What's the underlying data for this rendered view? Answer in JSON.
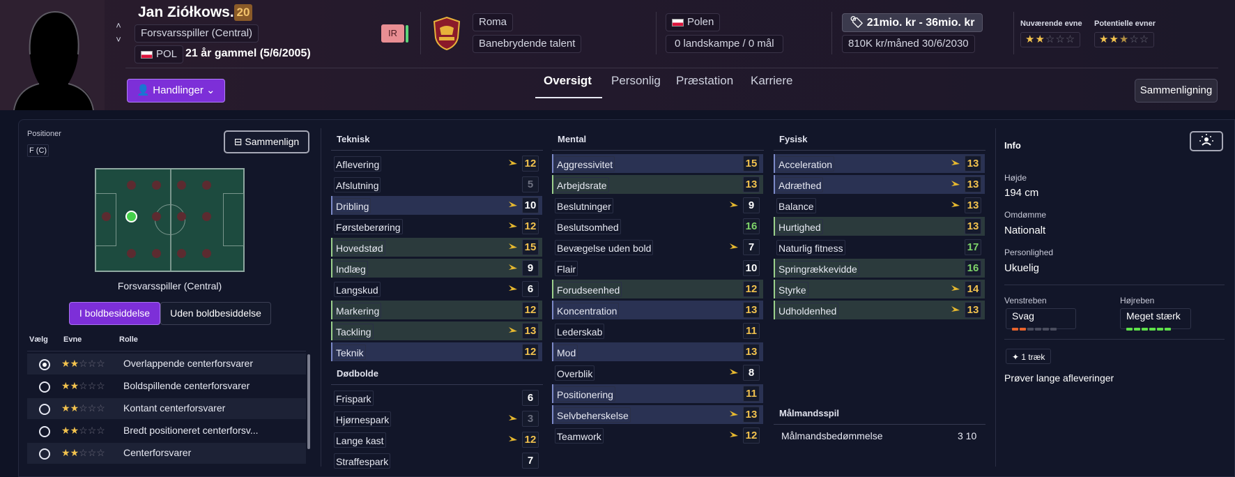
{
  "player": {
    "name": "Jan Ziółkows...",
    "age_badge": "20",
    "position_chip": "Forsvarsspiller (Central)",
    "nationality_code": "POL",
    "age_text": "21 år gammel (5/6/2005)",
    "injury_badge": "IR"
  },
  "club": {
    "name": "Roma",
    "status": "Banebrydende talent"
  },
  "nation": {
    "name": "Polen",
    "caps": "0 landskampe / 0 mål"
  },
  "contract": {
    "value": "21mio. kr - 36mio. kr",
    "wage": "810K kr/måned 30/6/2030"
  },
  "ability": {
    "current_label": "Nuværende evne",
    "current_stars": "★★☆☆☆",
    "current_level": 2,
    "potential_label": "Potentielle evner",
    "potential_stars": "★★★☆☆",
    "potential_level": 2.5
  },
  "nav": {
    "actions_label": "Handlinger",
    "tabs": [
      "Oversigt",
      "Personlig",
      "Præstation",
      "Karriere"
    ],
    "active_tab": "Oversigt",
    "compare_label": "Sammenligning"
  },
  "positions": {
    "label": "Positioner",
    "code": "F (C)",
    "compare_button": "Sammenlign",
    "selected_position": "Forsvarsspiller (Central)",
    "toggle_on": "I boldbesiddelse",
    "toggle_off": "Uden boldbesiddelse",
    "col_select": "Vælg",
    "col_ability": "Evne",
    "col_role": "Rolle",
    "roles": [
      {
        "name": "Overlappende centerforsvarer",
        "stars": 2,
        "selected": true
      },
      {
        "name": "Boldspillende centerforsvarer",
        "stars": 2,
        "selected": false
      },
      {
        "name": "Kontant centerforsvarer",
        "stars": 2,
        "selected": false
      },
      {
        "name": "Bredt positioneret centerforsv...",
        "stars": 2,
        "selected": false
      },
      {
        "name": "Centerforsvarer",
        "stars": 2,
        "selected": false
      }
    ]
  },
  "attributes": {
    "technical_title": "Teknisk",
    "technical": [
      {
        "name": "Aflevering",
        "value": "12",
        "color": "yellow",
        "trend": true,
        "hl": ""
      },
      {
        "name": "Afslutning",
        "value": "5",
        "color": "grey",
        "trend": false,
        "hl": ""
      },
      {
        "name": "Dribling",
        "value": "10",
        "color": "white",
        "trend": true,
        "hl": "blue"
      },
      {
        "name": "Førsteberøring",
        "value": "12",
        "color": "yellow",
        "trend": true,
        "hl": ""
      },
      {
        "name": "Hovedstød",
        "value": "15",
        "color": "yellow",
        "trend": true,
        "hl": "green"
      },
      {
        "name": "Indlæg",
        "value": "9",
        "color": "white",
        "trend": true,
        "hl": "green"
      },
      {
        "name": "Langskud",
        "value": "6",
        "color": "white",
        "trend": true,
        "hl": ""
      },
      {
        "name": "Markering",
        "value": "12",
        "color": "yellow",
        "trend": false,
        "hl": "green"
      },
      {
        "name": "Tackling",
        "value": "13",
        "color": "yellow",
        "trend": true,
        "hl": "green"
      },
      {
        "name": "Teknik",
        "value": "12",
        "color": "yellow",
        "trend": false,
        "hl": "blue"
      }
    ],
    "setpieces_title": "Dødbolde",
    "setpieces": [
      {
        "name": "Frispark",
        "value": "6",
        "color": "white",
        "trend": false,
        "hl": ""
      },
      {
        "name": "Hjørnespark",
        "value": "3",
        "color": "grey",
        "trend": true,
        "hl": ""
      },
      {
        "name": "Lange kast",
        "value": "12",
        "color": "yellow",
        "trend": true,
        "hl": ""
      },
      {
        "name": "Straffespark",
        "value": "7",
        "color": "white",
        "trend": false,
        "hl": ""
      }
    ],
    "mental_title": "Mental",
    "mental": [
      {
        "name": "Aggressivitet",
        "value": "15",
        "color": "yellow",
        "trend": false,
        "hl": "blue"
      },
      {
        "name": "Arbejdsrate",
        "value": "13",
        "color": "yellow",
        "trend": false,
        "hl": "green"
      },
      {
        "name": "Beslutninger",
        "value": "9",
        "color": "white",
        "trend": true,
        "hl": ""
      },
      {
        "name": "Beslutsomhed",
        "value": "16",
        "color": "green",
        "trend": false,
        "hl": ""
      },
      {
        "name": "Bevægelse uden bold",
        "value": "7",
        "color": "white",
        "trend": true,
        "hl": ""
      },
      {
        "name": "Flair",
        "value": "10",
        "color": "white",
        "trend": false,
        "hl": ""
      },
      {
        "name": "Forudseenhed",
        "value": "12",
        "color": "yellow",
        "trend": false,
        "hl": "green"
      },
      {
        "name": "Koncentration",
        "value": "13",
        "color": "yellow",
        "trend": false,
        "hl": "blue"
      },
      {
        "name": "Lederskab",
        "value": "11",
        "color": "yellow",
        "trend": false,
        "hl": ""
      },
      {
        "name": "Mod",
        "value": "13",
        "color": "yellow",
        "trend": false,
        "hl": "blue"
      },
      {
        "name": "Overblik",
        "value": "8",
        "color": "white",
        "trend": true,
        "hl": ""
      },
      {
        "name": "Positionering",
        "value": "11",
        "color": "yellow",
        "trend": false,
        "hl": "blue"
      },
      {
        "name": "Selvbeherskelse",
        "value": "13",
        "color": "yellow",
        "trend": true,
        "hl": "blue"
      },
      {
        "name": "Teamwork",
        "value": "12",
        "color": "yellow",
        "trend": true,
        "hl": ""
      }
    ],
    "physical_title": "Fysisk",
    "physical": [
      {
        "name": "Acceleration",
        "value": "13",
        "color": "yellow",
        "trend": true,
        "hl": "blue"
      },
      {
        "name": "Adræthed",
        "value": "13",
        "color": "yellow",
        "trend": true,
        "hl": "blue"
      },
      {
        "name": "Balance",
        "value": "13",
        "color": "yellow",
        "trend": true,
        "hl": ""
      },
      {
        "name": "Hurtighed",
        "value": "13",
        "color": "yellow",
        "trend": false,
        "hl": "green"
      },
      {
        "name": "Naturlig fitness",
        "value": "17",
        "color": "green",
        "trend": false,
        "hl": ""
      },
      {
        "name": "Springrækkevidde",
        "value": "16",
        "color": "green",
        "trend": false,
        "hl": "green"
      },
      {
        "name": "Styrke",
        "value": "14",
        "color": "yellow",
        "trend": true,
        "hl": "green"
      },
      {
        "name": "Udholdenhed",
        "value": "13",
        "color": "yellow",
        "trend": true,
        "hl": "green"
      }
    ],
    "gk_title": "Målmandsspil",
    "gk_label": "Målmandsbedømmelse",
    "gk_value": "3 10"
  },
  "info": {
    "title": "Info",
    "height_label": "Højde",
    "height": "194 cm",
    "reputation_label": "Omdømme",
    "reputation": "Nationalt",
    "personality_label": "Personlighed",
    "personality": "Ukuelig",
    "left_foot_label": "Venstreben",
    "left_foot": "Svag",
    "left_foot_level": 2,
    "right_foot_label": "Højreben",
    "right_foot": "Meget stærk",
    "right_foot_level": 6,
    "traits_badge": "1 træk",
    "trait": "Prøver lange afleveringer"
  },
  "colors": {
    "accent": "#7d2fd8",
    "value_yellow": "#f2c24e",
    "value_green": "#7ed46a"
  }
}
